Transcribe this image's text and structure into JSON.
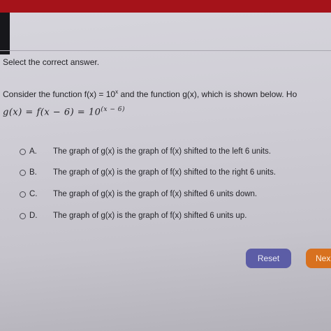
{
  "instruction": "Select the correct answer.",
  "question": {
    "prefix": "Consider the function ",
    "f": "f(x) = 10",
    "f_exp": "x",
    "middle": " and the function ",
    "g": "g(x)",
    "suffix": ", which is shown below. Ho"
  },
  "equation": {
    "text": "g(x)  =  f(x − 6)  =  10",
    "exponent": "(x − 6)"
  },
  "options": [
    {
      "letter": "A.",
      "text": "The graph of g(x) is the graph of f(x) shifted to the left 6 units."
    },
    {
      "letter": "B.",
      "text": "The graph of g(x) is the graph of f(x) shifted to the right 6 units."
    },
    {
      "letter": "C.",
      "text": "The graph of g(x) is the graph of f(x) shifted 6 units down."
    },
    {
      "letter": "D.",
      "text": "The graph of g(x) is the graph of f(x) shifted 6 units up."
    }
  ],
  "buttons": {
    "reset": "Reset",
    "next": "Nex"
  },
  "colors": {
    "top_bar": "#a5131a",
    "reset_button": "#5c5da6",
    "next_button": "#d8711f"
  }
}
